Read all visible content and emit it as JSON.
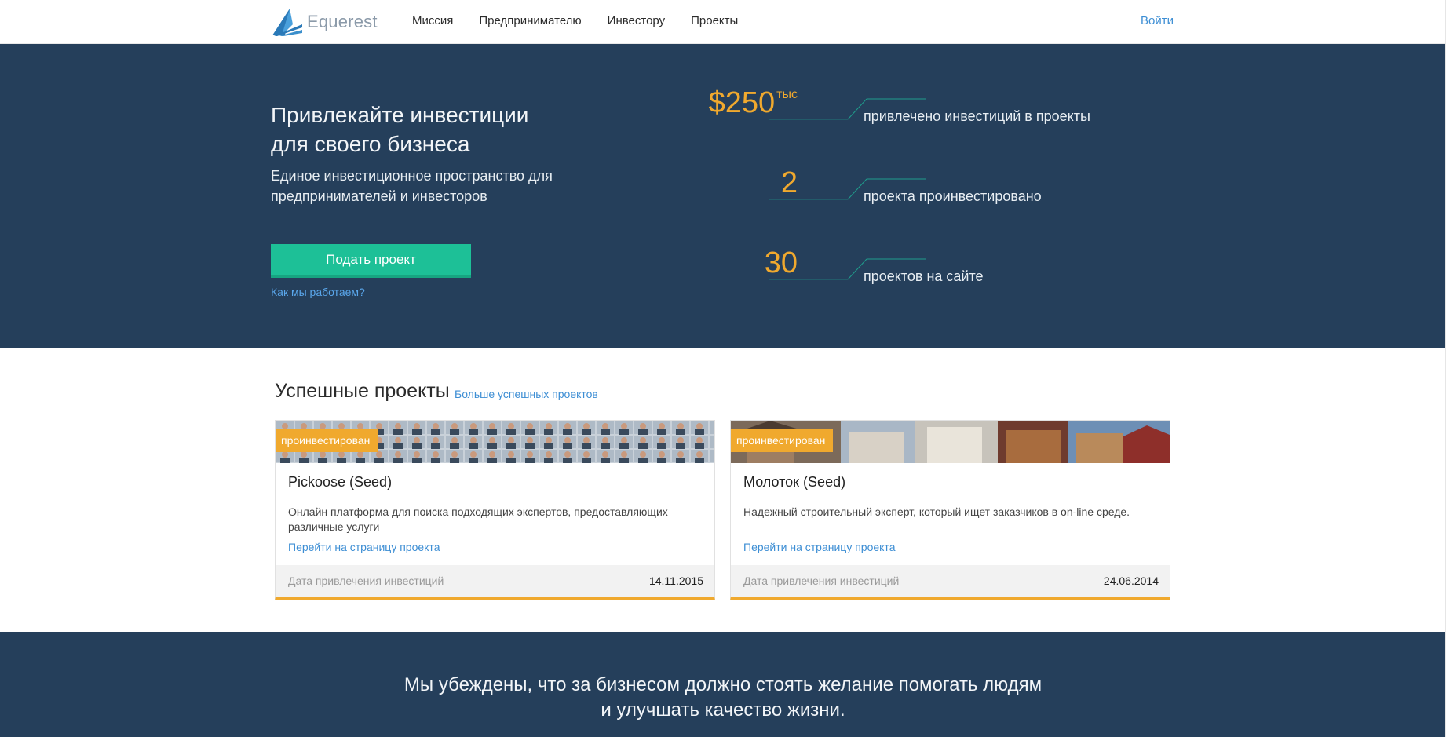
{
  "header": {
    "logo_text": "Equerest",
    "nav": [
      "Миссия",
      "Предпринимателю",
      "Инвестору",
      "Проекты"
    ],
    "login": "Войти"
  },
  "hero": {
    "title_line1": "Привлекайте инвестиции",
    "title_line2": "для своего бизнеса",
    "subtitle_line1": "Единое инвестиционное пространство для",
    "subtitle_line2": "предпринимателей и инвесторов",
    "cta": "Подать проект",
    "how_link": "Как мы работаем?"
  },
  "stats": [
    {
      "value": "$250",
      "suffix": "тыс",
      "label": "привлечено инвестиций в проекты"
    },
    {
      "value": "2",
      "suffix": "",
      "label": "проекта проинвестировано"
    },
    {
      "value": "30",
      "suffix": "",
      "label": "проектов на сайте"
    }
  ],
  "projects": {
    "title": "Успешные проекты",
    "more_link": "Больше успешных проектов",
    "items": [
      {
        "badge": "проинвестирован",
        "title": "Pickoose (Seed)",
        "desc": "Онлайн платформа для поиска подходящих экспертов, предоставляющих различные услуги",
        "link": "Перейти на страницу проекта",
        "date_label": "Дата привлечения инвестиций",
        "date": "14.11.2015"
      },
      {
        "badge": "проинвестирован",
        "title": "Молоток (Seed)",
        "desc": "Надежный строительный эксперт, который ищет заказчиков в on-line среде.",
        "link": "Перейти на страницу проекта",
        "date_label": "Дата привлечения инвестиций",
        "date": "24.06.2014"
      }
    ]
  },
  "band": {
    "line1": "Мы убеждены, что за бизнесом должно стоять желание помогать людям",
    "line2": "и улучшать качество жизни."
  },
  "colors": {
    "navy": "#253f5b",
    "accent_orange": "#f0a92e",
    "cta_green": "#1dc097",
    "link_blue": "#3d8ed4"
  }
}
